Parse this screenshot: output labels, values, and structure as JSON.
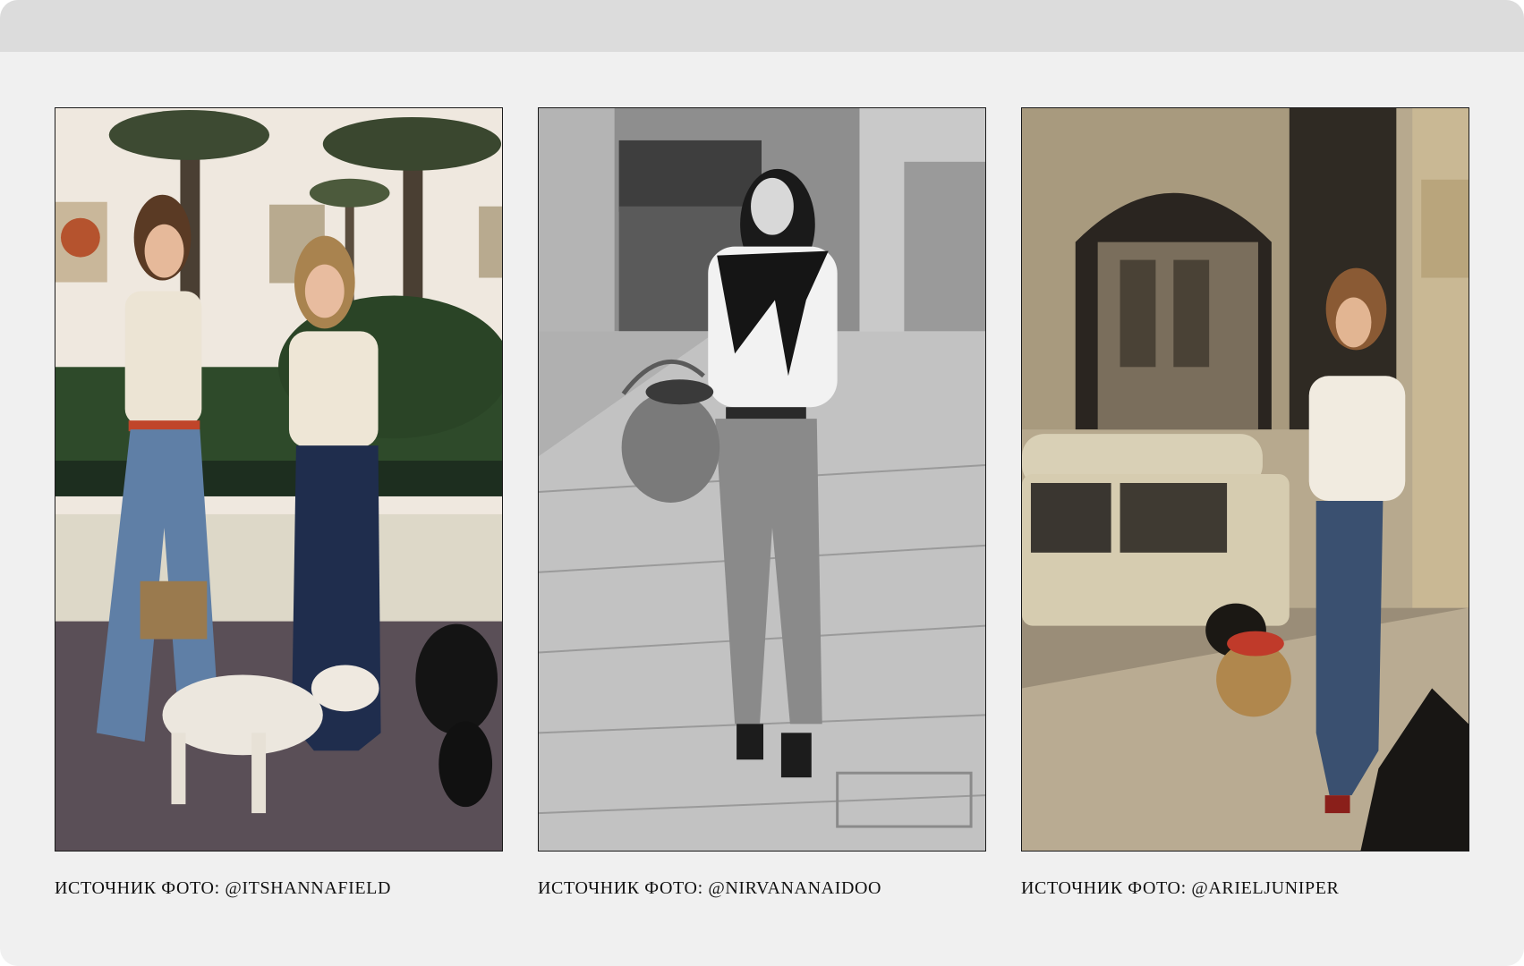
{
  "gallery": {
    "photos": [
      {
        "caption": "ИСТОЧНИК ФОТО: @ITSHANNAFIELD"
      },
      {
        "caption": "ИСТОЧНИК ФОТО: @NIRVANANAIDOO"
      },
      {
        "caption": "ИСТОЧНИК ФОТО: @ARIELJUNIPER"
      }
    ]
  }
}
